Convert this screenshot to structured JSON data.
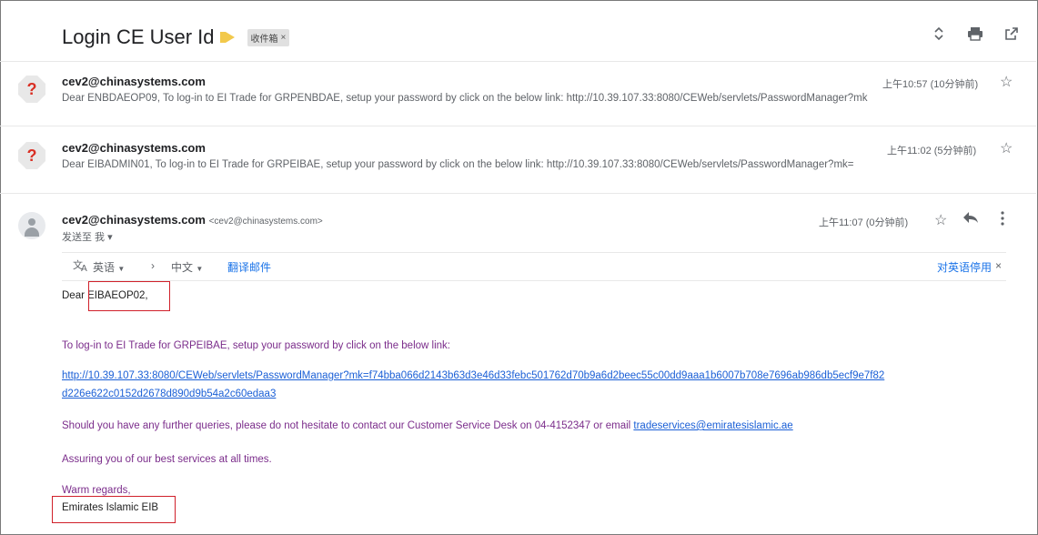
{
  "header": {
    "subject": "Login CE User Id",
    "label": "收件箱",
    "label_close": "×"
  },
  "icons": {
    "expand": "expand-icon",
    "print": "print-icon",
    "new_window": "open-new-window-icon"
  },
  "messages": [
    {
      "sender": "cev2@chinasystems.com",
      "snippet": "Dear ENBDAEOP09, To log-in to EI Trade for GRPENBDAE, setup your password by click on the below link: http://10.39.107.33:8080/CEWeb/servlets/PasswordManager?mk",
      "time": "上午10:57 (10分钟前)"
    },
    {
      "sender": "cev2@chinasystems.com",
      "snippet": "Dear EIBADMIN01, To log-in to EI Trade for GRPEIBAE, setup your password by click on the below link: http://10.39.107.33:8080/CEWeb/servlets/PasswordManager?mk=",
      "time": "上午11:02 (5分钟前)"
    }
  ],
  "open_message": {
    "sender": "cev2@chinasystems.com",
    "sender_email": "<cev2@chinasystems.com>",
    "recipient": "发送至 我 ▾",
    "time": "上午11:07 (0分钟前)"
  },
  "translate_bar": {
    "source_lang": "英语",
    "arrow": "›",
    "target_lang": "中文",
    "translate_link": "翻译邮件",
    "disable_link": "对英语停用",
    "close": "×"
  },
  "body": {
    "greeting_prefix": "Dear ",
    "greeting_name": "EIBAEOP02,",
    "line1": "To log-in to EI Trade for GRPEIBAE, setup your password by click on the below link:",
    "link_line1": "http://10.39.107.33:8080/CEWeb/servlets/PasswordManager?mk=f74bba066d2143b63d3e46d33febc501762d70b9a6d2beec55c00dd9aaa1b6007b708e7696ab986db5ecf9e7f82",
    "link_line2": "d226e622c0152d2678d890d9b54a2c60edaa3",
    "contact_prefix": "Should you have any further queries, please do not hesitate to contact our Customer Service Desk on 04-4152347 or email ",
    "contact_email": "tradeservices@emiratesislamic.ae",
    "assuring": "Assuring you of our best services at all times.",
    "regards": "Warm regards,",
    "signature": "Emirates Islamic EIB"
  }
}
